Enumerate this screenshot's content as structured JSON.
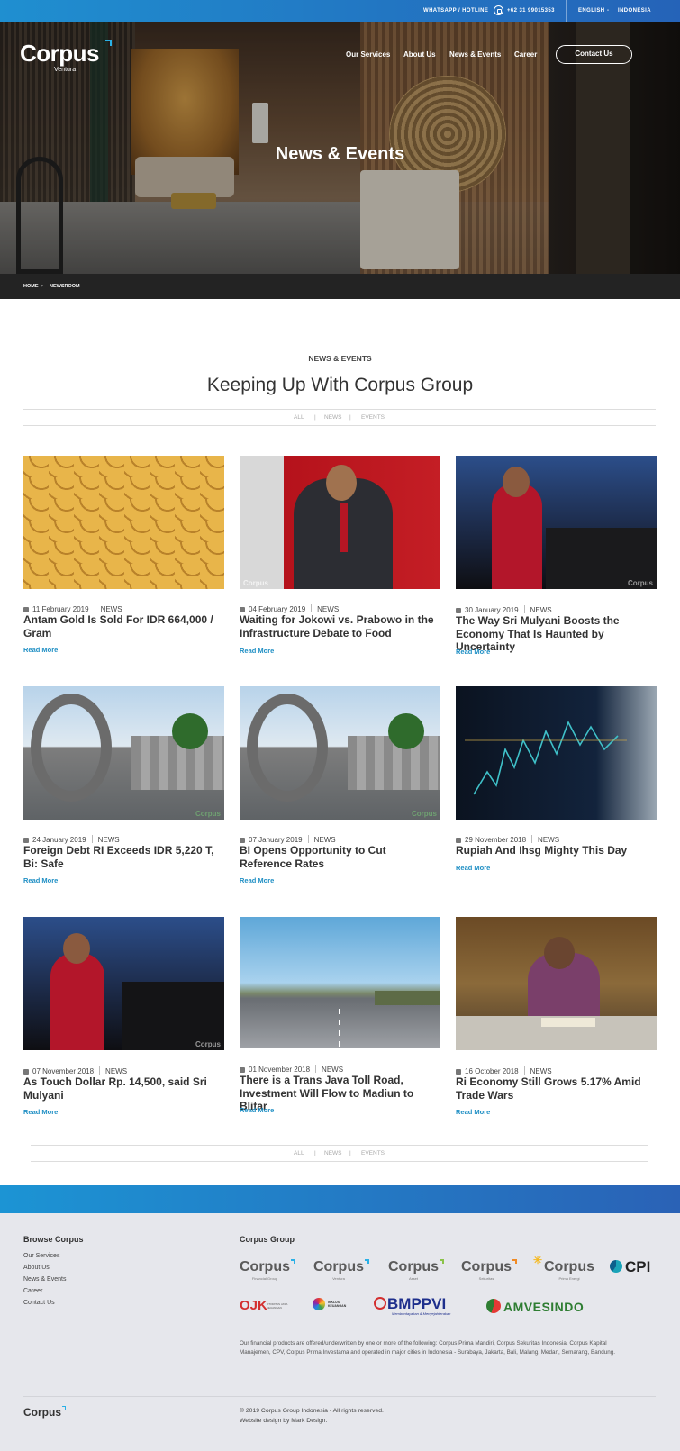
{
  "topbar": {
    "hotline_label": "WHATSAPP / HOTLINE",
    "phone": "+62 31 99015353",
    "language": "ENGLISH",
    "dash": "-",
    "country": "INDONESIA"
  },
  "brand": {
    "name": "Corpus",
    "sub": "Ventura"
  },
  "nav": {
    "items": [
      "Our Services",
      "About Us",
      "News & Events",
      "Career"
    ],
    "contact": "Contact Us"
  },
  "hero": {
    "title": "News & Events"
  },
  "breadcrumb": {
    "home": "HOME",
    "sep": ">",
    "current": "NEWSROOM"
  },
  "section": {
    "eyebrow": "NEWS & EVENTS",
    "title": "Keeping Up With Corpus Group",
    "filters": [
      "ALL",
      "|",
      "NEWS",
      "|",
      "EVENTS"
    ]
  },
  "watermark": "Corpus",
  "read_more": "Read More",
  "posts": [
    {
      "date": "11 February 2019",
      "category": "NEWS",
      "title": "Antam Gold Is Sold For IDR 664,000 / Gram",
      "image": "gold-roof-tiles"
    },
    {
      "date": "04 February 2019",
      "category": "NEWS",
      "title": "Waiting for Jokowi vs. Prabowo in the Infrastructure Debate to Food",
      "image": "president-speaking"
    },
    {
      "date": "30 January 2019",
      "category": "NEWS",
      "title": "The Way Sri Mulyani Boosts the Economy That Is Haunted by Uncertainty",
      "image": "minister-podium"
    },
    {
      "date": "24 January 2019",
      "category": "NEWS",
      "title": "Foreign Debt RI Exceeds IDR 5,220 T, Bi: Safe",
      "image": "bank-indonesia-logo"
    },
    {
      "date": "07 January 2019",
      "category": "NEWS",
      "title": "BI Opens Opportunity to Cut Reference Rates",
      "image": "bank-indonesia-logo"
    },
    {
      "date": "29 November 2018",
      "category": "NEWS",
      "title": "Rupiah And Ihsg Mighty This Day",
      "image": "stock-chart"
    },
    {
      "date": "07 November 2018",
      "category": "NEWS",
      "title": "As Touch Dollar Rp. 14,500, said Sri Mulyani",
      "image": "minister-podium"
    },
    {
      "date": "01 November 2018",
      "category": "NEWS",
      "title": "There is a Trans Java Toll Road, Investment Will Flow to Madiun to Blitar",
      "image": "toll-road"
    },
    {
      "date": "16 October 2018",
      "category": "NEWS",
      "title": "Ri Economy Still Grows 5.17% Amid Trade Wars",
      "image": "minister-meeting"
    }
  ],
  "footer": {
    "browse_title": "Browse Corpus",
    "links": [
      "Our Services",
      "About Us",
      "News & Events",
      "Career",
      "Contact Us"
    ],
    "group_title": "Corpus Group",
    "group_logos": [
      {
        "name": "Corpus",
        "caption": "Financial Group"
      },
      {
        "name": "Corpus",
        "caption": "Ventura"
      },
      {
        "name": "Corpus",
        "caption": "Asset"
      },
      {
        "name": "Corpus",
        "caption": "Sekuritas"
      },
      {
        "name": "Corpus",
        "caption": "Prima Energi"
      },
      {
        "name": "CPI",
        "caption": ""
      }
    ],
    "partners": [
      "OJK",
      "BMPPVI",
      "AMVESINDO"
    ],
    "partner_captions": {
      "ojk": "OTORITAS JASA KEUANGAN",
      "inklusi": "INKLUSI KEUANGAN",
      "bmppvi": "Memberdayakan & Menyejahterakan"
    },
    "disclaimer": "Our financial products are offered/underwritten by one or more of the following: Corpus Prima Mandiri, Corpus Sekuritas Indonesia, Corpus Kapital Manajemen, CPV, Corpus Prima Investama and operated in major cities in Indonesia - Surabaya, Jakarta, Bali, Malang, Medan, Semarang, Bandung.",
    "logo": "Corpus",
    "copyright": "© 2019 Corpus Group Indonesia - All rights reserved.",
    "credit": "Website design by Mark Design."
  },
  "colors": {
    "accent": "#1f8fc4",
    "topbar_start": "#1f8fd0",
    "topbar_end": "#2563b8",
    "footer_bg": "#e6e7ec"
  }
}
